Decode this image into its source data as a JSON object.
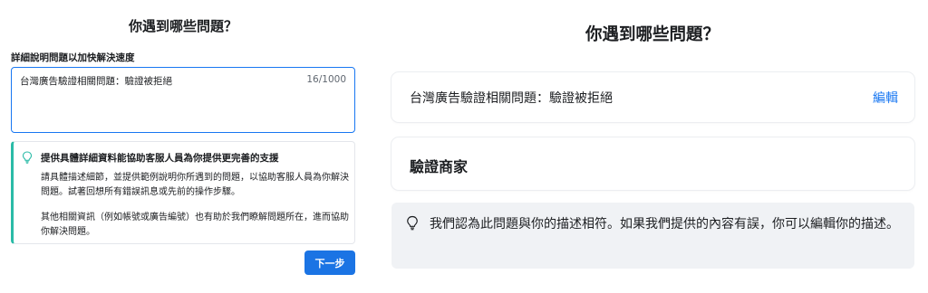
{
  "left": {
    "title": "你遇到哪些問題？",
    "field_label": "詳細說明問題以加快解決速度",
    "textarea_value": "台灣廣告驗證相關問題：驗證被拒絕",
    "char_count": "16/1000",
    "tip": {
      "icon": "lightbulb-icon",
      "title": "提供具體詳細資料能協助客服人員為你提供更完善的支援",
      "para1": "請具體描述細節，並提供範例說明你所遇到的問題，以協助客服人員為你解決問題。試著回想所有錯誤訊息或先前的操作步驟。",
      "para2": "其他相關資訊（例如帳號或廣告編號）也有助於我們瞭解問題所在，進而協助你解決問題。"
    },
    "next_button": "下一步"
  },
  "right": {
    "title": "你遇到哪些問題？",
    "issue": "台灣廣告驗證相關問題：驗證被拒絕",
    "edit_link": "編輯",
    "category": "驗證商家",
    "note_icon": "lightbulb-icon",
    "note": "我們認為此問題與你的描述相符。如果我們提供的內容有誤，你可以編輯你的描述。"
  },
  "colors": {
    "accent": "#1877f2",
    "button": "#1b74e4",
    "tip_border": "#2abba7",
    "note_bg": "#f0f2f5"
  }
}
